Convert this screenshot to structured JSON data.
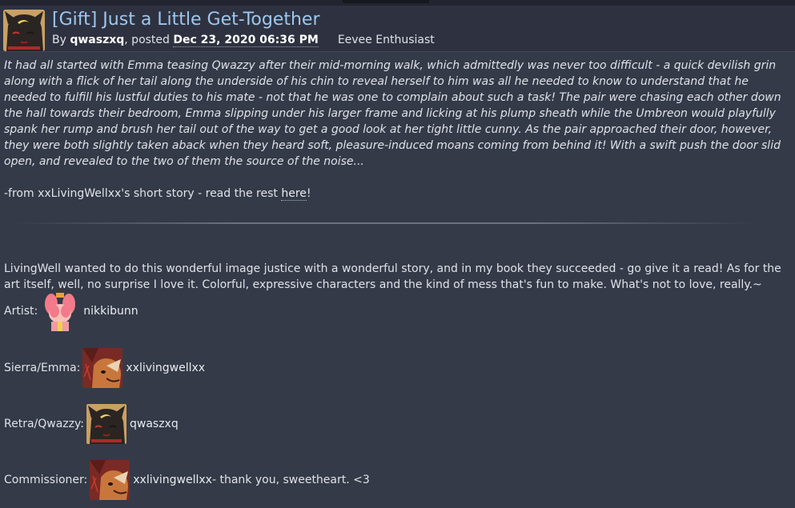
{
  "post": {
    "title": "[Gift] Just a Little Get-Together",
    "by_prefix": "By ",
    "author": "qwaszxq",
    "posted_prefix": ", posted ",
    "date": "Dec 23, 2020 06:36 PM",
    "user_title": "Eevee Enthusiast"
  },
  "content": {
    "story_excerpt": "It had all started with Emma teasing Qwazzy after their mid-morning walk, which admittedly was never too difficult - a quick devilish grin along with a flick of her tail along the underside of his chin to reveal herself to him was all he needed to know to understand that he needed to fulfill his lustful duties to his mate - not that he was one to complain about such a task! The pair were chasing each other down the hall towards their bedroom, Emma slipping under his larger frame and licking at his plump sheath while the Umbreon would playfully spank her rump and brush her tail out of the way to get a good look at her tight little cunny. As the pair approached their door, however, they were both slightly taken aback when they heard soft, pleasure-induced moans coming from behind it! With a swift push the door slid open, and revealed to the two of them the source of the noise...",
    "from_prefix": "-from xxLivingWellxx's short story - read the rest ",
    "from_link": "here",
    "from_suffix": "!",
    "description": "LivingWell wanted to do this wonderful image justice with a wonderful story, and in my book they succeeded - go give it a read! As for the art itself, well, no surprise I love it. Colorful, expressive characters and the kind of mess that's fun to make. What's not to love, really.~"
  },
  "credits": [
    {
      "label": "Artist:",
      "name": "nikkibunn",
      "extra": "",
      "icon": "pink-bunny-avatar-icon"
    },
    {
      "label": "Sierra/Emma:",
      "name": "xxlivingwellxx",
      "extra": "",
      "icon": "fox-avatar-icon"
    },
    {
      "label": "Retra/Qwazzy:",
      "name": "qwaszxq",
      "extra": "",
      "icon": "umbreon-avatar-icon"
    },
    {
      "label": "Commissioner:",
      "name": "xxlivingwellxx",
      "extra": " - thank you, sweetheart. <3",
      "icon": "fox-avatar-icon"
    }
  ],
  "colors": {
    "background": "#353a48",
    "title": "#9ec7ee",
    "text": "#dfe2e8"
  }
}
